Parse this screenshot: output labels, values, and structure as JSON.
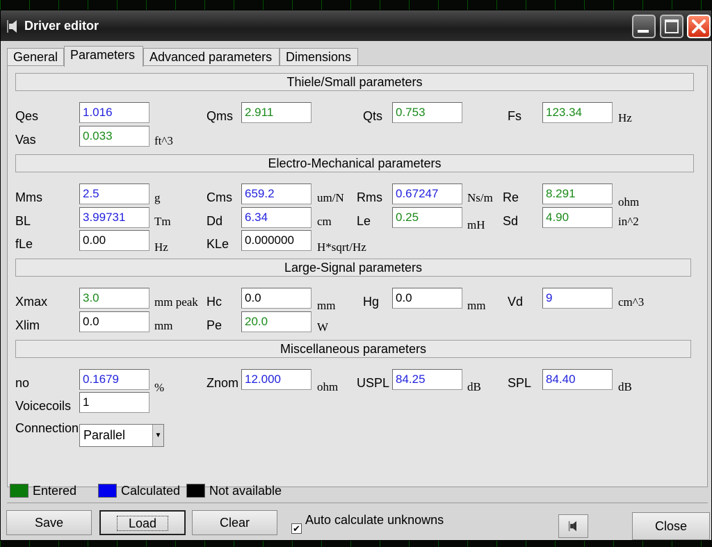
{
  "window": {
    "title": "Driver editor"
  },
  "tabs": [
    "General",
    "Parameters",
    "Advanced parameters",
    "Dimensions"
  ],
  "sections": {
    "thiele_small": "Thiele/Small parameters",
    "electro_mechanical": "Electro-Mechanical parameters",
    "large_signal": "Large-Signal parameters",
    "misc": "Miscellaneous parameters"
  },
  "fields": {
    "qes": {
      "label": "Qes",
      "value": "1.016"
    },
    "qms": {
      "label": "Qms",
      "value": "2.911"
    },
    "qts": {
      "label": "Qts",
      "value": "0.753"
    },
    "fs": {
      "label": "Fs",
      "value": "123.34",
      "unit": "Hz"
    },
    "vas": {
      "label": "Vas",
      "value": "0.033",
      "unit": "ft^3"
    },
    "mms": {
      "label": "Mms",
      "value": "2.5",
      "unit": "g"
    },
    "cms": {
      "label": "Cms",
      "value": "659.2",
      "unit": "um/N"
    },
    "rms": {
      "label": "Rms",
      "value": "0.67247",
      "unit": "Ns/m"
    },
    "re": {
      "label": "Re",
      "value": "8.291",
      "unit": "ohm"
    },
    "bl": {
      "label": "BL",
      "value": "3.99731",
      "unit": "Tm"
    },
    "dd": {
      "label": "Dd",
      "value": "6.34",
      "unit": "cm"
    },
    "le": {
      "label": "Le",
      "value": "0.25",
      "unit": "mH"
    },
    "sd": {
      "label": "Sd",
      "value": "4.90",
      "unit": "in^2"
    },
    "fle": {
      "label": "fLe",
      "value": "0.00",
      "unit": "Hz"
    },
    "kle": {
      "label": "KLe",
      "value": "0.000000",
      "unit": "H*sqrt/Hz"
    },
    "xmax": {
      "label": "Xmax",
      "value": "3.0",
      "unit": "mm peak"
    },
    "hc": {
      "label": "Hc",
      "value": "0.0",
      "unit": "mm"
    },
    "hg": {
      "label": "Hg",
      "value": "0.0",
      "unit": "mm"
    },
    "vd": {
      "label": "Vd",
      "value": "9",
      "unit": "cm^3"
    },
    "xlim": {
      "label": "Xlim",
      "value": "0.0",
      "unit": "mm"
    },
    "pe": {
      "label": "Pe",
      "value": "20.0",
      "unit": "W"
    },
    "no": {
      "label": "no",
      "value": "0.1679",
      "unit": "%"
    },
    "znom": {
      "label": "Znom",
      "value": "12.000",
      "unit": "ohm"
    },
    "uspl": {
      "label": "USPL",
      "value": "84.25",
      "unit": "dB"
    },
    "spl": {
      "label": "SPL",
      "value": "84.40",
      "unit": "dB"
    },
    "voicecoils": {
      "label": "Voicecoils",
      "value": "1"
    },
    "connection": {
      "label": "Connection",
      "value": "Parallel"
    }
  },
  "legend": {
    "entered": "Entered",
    "calculated": "Calculated",
    "not_available": "Not available"
  },
  "colors": {
    "entered": "#0a7a0a",
    "calculated": "#0000ee",
    "not_available": "#000000"
  },
  "buttons": {
    "save": "Save",
    "load": "Load",
    "clear": "Clear",
    "auto_calc": "Auto calculate unknowns",
    "auto_calc_checked": true,
    "close": "Close"
  },
  "icons": {
    "window": "speaker-icon",
    "driver_button": "speaker-icon"
  }
}
